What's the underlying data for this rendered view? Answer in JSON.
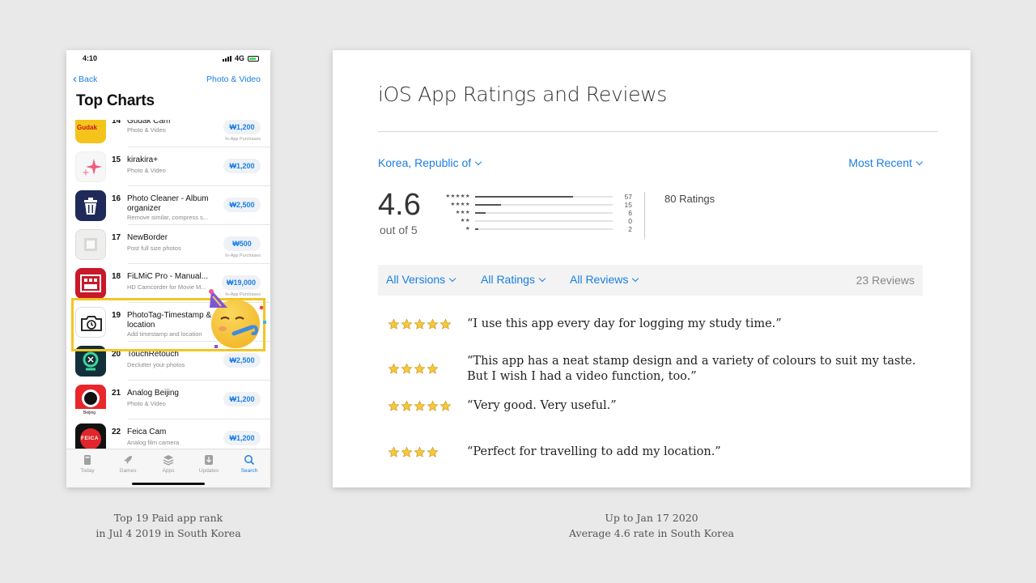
{
  "phone": {
    "status": {
      "time": "4:10",
      "network": "4G"
    },
    "nav": {
      "back_label": "Back",
      "category_label": "Photo & Video"
    },
    "title": "Top Charts",
    "apps": [
      {
        "rank": "14",
        "name": "Gudak Cam",
        "subtitle": "Photo & Video",
        "price": "₩1,200",
        "iap": "In-App Purchases",
        "icon": "gudak-icon",
        "icon_text": "Gudak"
      },
      {
        "rank": "15",
        "name": "kirakira+",
        "subtitle": "Photo & Video",
        "price": "₩1,200",
        "iap": "",
        "icon": "sparkle-icon"
      },
      {
        "rank": "16",
        "name": "Photo Cleaner - Album organizer",
        "subtitle": "Remove similar, compress s...",
        "price": "₩2,500",
        "iap": "",
        "icon": "trash-icon"
      },
      {
        "rank": "17",
        "name": "NewBorder",
        "subtitle": "Post full size photos",
        "price": "₩500",
        "iap": "In-App Purchases",
        "icon": "square-frame-icon"
      },
      {
        "rank": "18",
        "name": "FiLMiC Pro - Manual...",
        "subtitle": "HD Camcorder for Movie M...",
        "price": "₩19,000",
        "iap": "In-App Purchases",
        "icon": "film-camera-icon"
      },
      {
        "rank": "19",
        "name": "PhotoTag-Timestamp & location",
        "subtitle": "Add timestamp and location",
        "price": "",
        "iap": "",
        "icon": "camera-clock-icon"
      },
      {
        "rank": "20",
        "name": "TouchRetouch",
        "subtitle": "Declutter your photos",
        "price": "₩2,500",
        "iap": "",
        "icon": "retouch-icon"
      },
      {
        "rank": "21",
        "name": "Analog Beijing",
        "subtitle": "Photo & Video",
        "price": "₩1,200",
        "iap": "",
        "icon": "analog-beijing-icon",
        "icon_text": "Beijing"
      },
      {
        "rank": "22",
        "name": "Feica Cam",
        "subtitle": "Analog film camera",
        "price": "₩1,200",
        "iap": "",
        "icon": "feica-icon",
        "icon_text": "FEICA"
      }
    ],
    "tabs": [
      {
        "label": "Today",
        "icon": "today-icon"
      },
      {
        "label": "Games",
        "icon": "rocket-icon"
      },
      {
        "label": "Apps",
        "icon": "layers-icon"
      },
      {
        "label": "Updates",
        "icon": "download-icon"
      },
      {
        "label": "Search",
        "icon": "search-icon",
        "active": true
      }
    ],
    "highlight_color": "#f3c623"
  },
  "ratings": {
    "title": "iOS App Ratings and Reviews",
    "country": "Korea, Republic of",
    "sort": "Most Recent",
    "average": "4.6",
    "out_of": "out of 5",
    "histogram": [
      {
        "stars": "★★★★★",
        "count": "57",
        "value": 57
      },
      {
        "stars": "★★★★",
        "count": "15",
        "value": 15
      },
      {
        "stars": "★★★",
        "count": "6",
        "value": 6
      },
      {
        "stars": "★★",
        "count": "0",
        "value": 0
      },
      {
        "stars": "★",
        "count": "2",
        "value": 2
      }
    ],
    "total_label": "80 Ratings",
    "filters": {
      "versions": "All Versions",
      "ratings": "All Ratings",
      "reviews": "All Reviews"
    },
    "review_count": "23 Reviews",
    "reviews": [
      {
        "stars": 5,
        "text": "“I use this app every day for logging my study time.”"
      },
      {
        "stars": 4,
        "text": "“This app has a neat stamp design and a variety of colours to suit my taste. But I wish I had a video function, too.”"
      },
      {
        "stars": 5,
        "text": "“Very good. Very useful.”"
      },
      {
        "stars": 4,
        "text": "“Perfect for travelling to add my location.”"
      }
    ],
    "accent": "#1a7ee6"
  },
  "captions": {
    "left": [
      "Top 19 Paid app rank",
      "in Jul 4 2019 in South Korea"
    ],
    "right": [
      "Up to Jan 17 2020",
      "Average 4.6 rate in South Korea"
    ]
  }
}
